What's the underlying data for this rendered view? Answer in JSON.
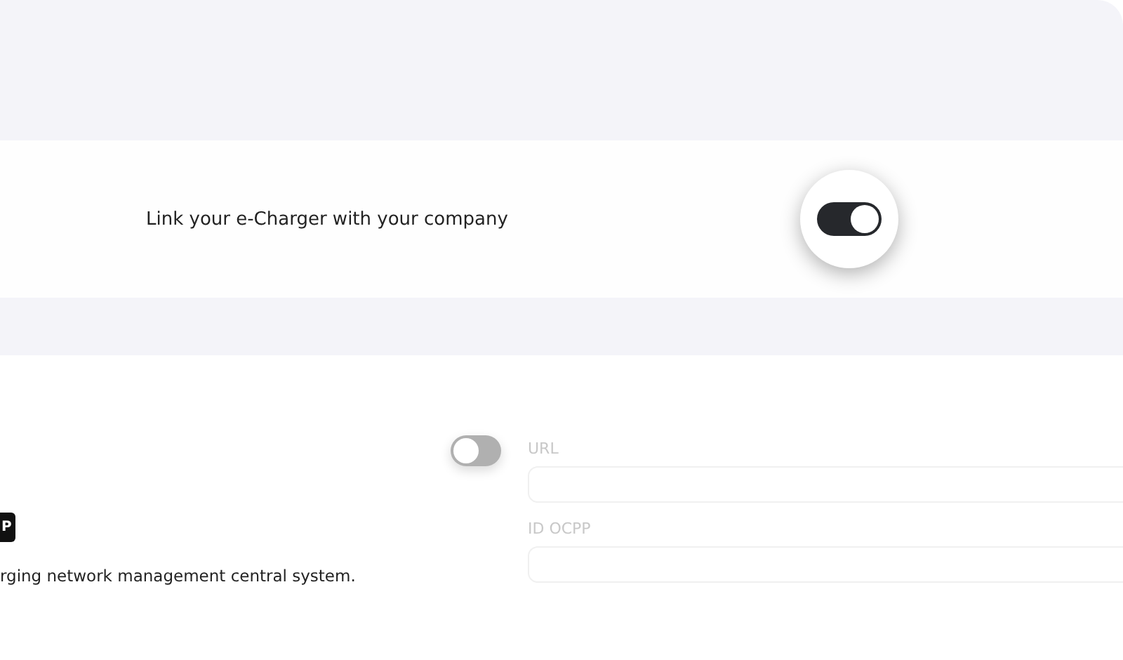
{
  "link_section": {
    "label": "Link your e-Charger with your company",
    "toggle": {
      "on": true
    }
  },
  "ocpp_section": {
    "toggle": {
      "on": false
    },
    "badge": "P",
    "description": "rging network management central system.",
    "fields": [
      {
        "label": "URL"
      },
      {
        "label": "ID OCPP"
      }
    ]
  }
}
